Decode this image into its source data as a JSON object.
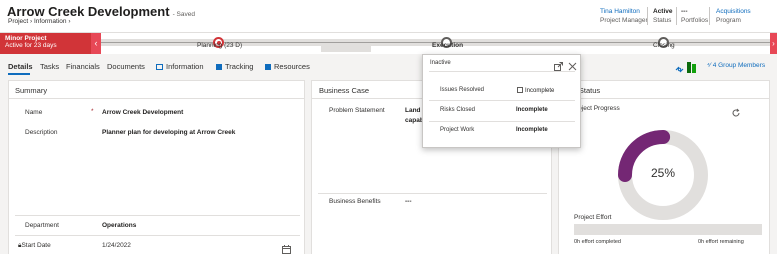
{
  "header": {
    "title": "Arrow Creek Development",
    "saved_status": "- Saved",
    "breadcrumb": "Project  ›  Information  ›",
    "owner": {
      "value": "Tina Hamilton",
      "label": "Project Manager"
    },
    "status": {
      "value": "Active",
      "label": "Status"
    },
    "portfolio": {
      "value": "---",
      "label": "Portfolios"
    },
    "program": {
      "value": "Acquisitions",
      "label": "Program"
    }
  },
  "process": {
    "active_stage_box": {
      "title": "Minor Project",
      "subtitle": "Active for 23 days"
    },
    "stages": [
      {
        "label": "Planning  (23 D)"
      },
      {
        "label": "Execution"
      },
      {
        "label": "Closing"
      }
    ],
    "left_arrow": "‹",
    "right_arrow": "›"
  },
  "tabs": [
    "Details",
    "Tasks",
    "Financials",
    "Documents",
    "Information",
    "Tracking",
    "Resources"
  ],
  "group_members": "4 Group Members",
  "summary": {
    "title": "Summary",
    "name_label": "Name",
    "required_mark": "*",
    "name_value": "Arrow Creek Development",
    "description_label": "Description",
    "description_value": "Planner plan for developing at Arrow Creek",
    "department_label": "Department",
    "department_value": "Operations",
    "start_label": "Start Date",
    "start_value": "1/24/2022"
  },
  "business_case": {
    "title": "Business Case",
    "problem_label": "Problem Statement",
    "problem_value_line1": "Land n",
    "problem_value_line2": "capab",
    "benefits_label": "Business Benefits",
    "benefits_value": "---"
  },
  "project_status": {
    "title": "ct Status",
    "progress_label": "roject Progress",
    "progress_percent": 25,
    "progress_text": "25%",
    "effort_label": "Project Effort",
    "effort_completed": "0h effort completed",
    "effort_remaining": "0h effort remaining",
    "donut_color": "#742774"
  },
  "popup": {
    "title": "Inactive",
    "rows": [
      {
        "label": "Issues Resolved",
        "value": "Incomplete",
        "checkbox": true
      },
      {
        "label": "Risks Closed",
        "value": "Incomplete",
        "checkbox": false
      },
      {
        "label": "Project Work",
        "value": "Incomplete",
        "checkbox": false
      }
    ]
  },
  "colors": {
    "accent": "#0f6cbd",
    "alert": "#d13438",
    "donut": "#742774"
  }
}
